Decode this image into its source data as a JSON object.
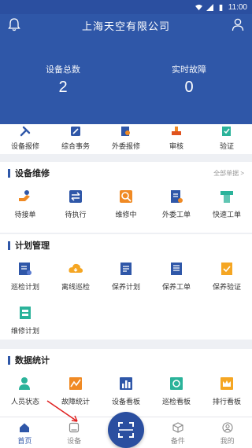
{
  "status": {
    "time": "11:00"
  },
  "header": {
    "title": "上海天空有限公司",
    "stats": [
      {
        "label": "设备总数",
        "value": "2"
      },
      {
        "label": "实时故障",
        "value": "0"
      }
    ]
  },
  "quick_row": [
    {
      "label": "设备报修",
      "icon": "wrench-icon"
    },
    {
      "label": "综合事务",
      "icon": "pen-icon"
    },
    {
      "label": "外委报修",
      "icon": "search-doc-icon"
    },
    {
      "label": "审核",
      "icon": "stamp-icon"
    },
    {
      "label": "验证",
      "icon": "check-doc-icon"
    }
  ],
  "sections": {
    "repair": {
      "title": "设备维修",
      "more": "全部单据 >",
      "items": [
        {
          "label": "待接单",
          "icon": "hand-icon"
        },
        {
          "label": "待执行",
          "icon": "arrows-icon"
        },
        {
          "label": "维修中",
          "icon": "repair-search-icon"
        },
        {
          "label": "外委工单",
          "icon": "outsource-doc-icon"
        },
        {
          "label": "快速工单",
          "icon": "quick-ticket-icon"
        }
      ]
    },
    "plan": {
      "title": "计划管理",
      "items": [
        {
          "label": "巡检计划",
          "icon": "inspect-plan-icon"
        },
        {
          "label": "离线巡检",
          "icon": "cloud-icon"
        },
        {
          "label": "保养计划",
          "icon": "maint-plan-icon"
        },
        {
          "label": "保养工单",
          "icon": "maint-ticket-icon"
        },
        {
          "label": "保养验证",
          "icon": "maint-verify-icon"
        },
        {
          "label": "维修计划",
          "icon": "repair-plan-icon"
        }
      ]
    },
    "stats": {
      "title": "数据统计",
      "items": [
        {
          "label": "人员状态",
          "icon": "person-icon"
        },
        {
          "label": "故障统计",
          "icon": "fault-chart-icon"
        },
        {
          "label": "设备看板",
          "icon": "bar-chart-icon"
        },
        {
          "label": "巡检看板",
          "icon": "inspect-board-icon"
        },
        {
          "label": "排行看板",
          "icon": "crown-icon"
        }
      ]
    }
  },
  "bottom_nav": [
    {
      "label": "首页",
      "icon": "home-icon",
      "active": true
    },
    {
      "label": "设备",
      "icon": "device-icon",
      "active": false
    },
    {
      "label": "备件",
      "icon": "box-icon",
      "active": false
    },
    {
      "label": "我的",
      "icon": "profile-icon",
      "active": false
    }
  ],
  "colors": {
    "primary": "#2f57a8",
    "orange": "#f08a24",
    "teal": "#2bb39a"
  }
}
